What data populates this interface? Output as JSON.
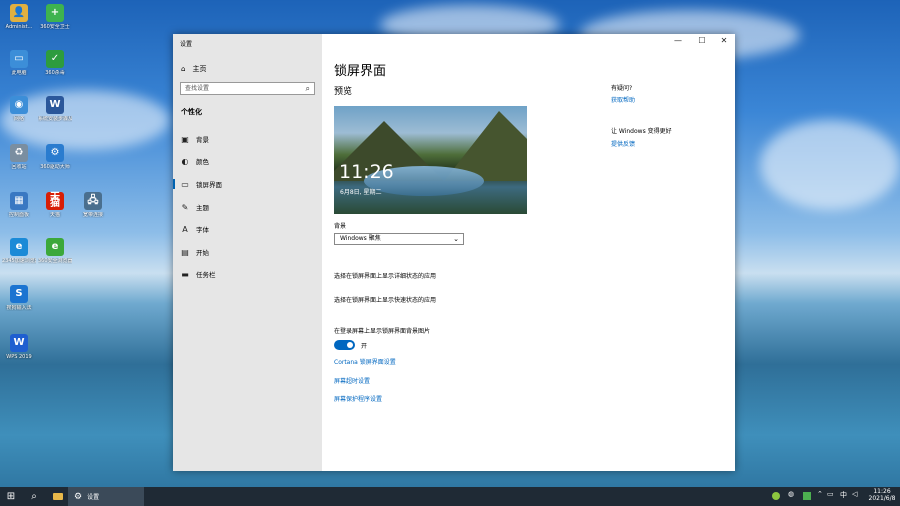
{
  "desktop": {
    "icons": [
      {
        "label": "Administ...",
        "glyph": "👤",
        "color": "#e0b040"
      },
      {
        "label": "360安全卫士",
        "glyph": "+",
        "color": "#3eb34f"
      },
      {
        "label": "此电脑",
        "glyph": "▭",
        "color": "#3c8ed8"
      },
      {
        "label": "360杀毒",
        "glyph": "✓",
        "color": "#2d9c3e"
      },
      {
        "label": "网络",
        "glyph": "◉",
        "color": "#3c8ed8"
      },
      {
        "label": "系统安装步骤及\n须.docx",
        "glyph": "W",
        "color": "#2b579a"
      },
      {
        "label": "回收站",
        "glyph": "♻",
        "color": "#7a8ea0"
      },
      {
        "label": "360驱动大师",
        "glyph": "⚙",
        "color": "#2a7ccf"
      },
      {
        "label": "控制面板",
        "glyph": "▦",
        "color": "#3a78c2"
      },
      {
        "label": "天猫",
        "glyph": "天猫",
        "color": "#d81e06"
      },
      {
        "label": "宽带连接",
        "glyph": "🖧",
        "color": "#4a6f8e"
      },
      {
        "label": "2345加速浏览器",
        "glyph": "e",
        "color": "#1a8ad7"
      },
      {
        "label": "360安全浏览器",
        "glyph": "e",
        "color": "#3ca83a"
      },
      {
        "label": "搜狗输入法",
        "glyph": "S",
        "color": "#1b74d1"
      },
      {
        "label": "WPS 2019",
        "glyph": "W",
        "color": "#1f5fd0"
      }
    ]
  },
  "window": {
    "title": "设置",
    "controls": {
      "minimize": "—",
      "maximize": "☐",
      "close": "✕"
    },
    "sidebar": {
      "home_label": "主页",
      "home_icon": "⌂",
      "search_placeholder": "查找设置",
      "search_icon": "⌕",
      "section_title": "个性化",
      "items": [
        {
          "label": "背景",
          "icon": "▣"
        },
        {
          "label": "颜色",
          "icon": "◐"
        },
        {
          "label": "锁屏界面",
          "icon": "▭"
        },
        {
          "label": "主题",
          "icon": "✎"
        },
        {
          "label": "字体",
          "icon": "A"
        },
        {
          "label": "开始",
          "icon": "▤"
        },
        {
          "label": "任务栏",
          "icon": "▬"
        }
      ]
    },
    "main": {
      "page_title": "锁屏界面",
      "preview_heading": "预览",
      "preview_time": "11:26",
      "preview_date": "6月8日, 星期二",
      "background_label": "背景",
      "background_value": "Windows 聚焦",
      "detail_status_text": "选择在锁屏界面上显示详细状态的应用",
      "quick_status_text": "选择在锁屏界面上显示快速状态的应用",
      "show_bg_label": "在登录屏幕上显示锁屏界面背景图片",
      "toggle_state": "开",
      "links": [
        "Cortana 锁屏界面设置",
        "屏幕超时设置",
        "屏幕保护程序设置"
      ]
    },
    "help": {
      "question": "有疑问?",
      "get_help": "获取帮助",
      "improve": "让 Windows 变得更好",
      "feedback": "提供反馈"
    }
  },
  "taskbar": {
    "start_icon": "⊞",
    "search_icon": "⌕",
    "app_label": "设置",
    "time": "11:26",
    "date": "2021/6/8",
    "ime": "中",
    "colors": {
      "bg": "#1f2a35",
      "accent": "#0067c0"
    }
  }
}
